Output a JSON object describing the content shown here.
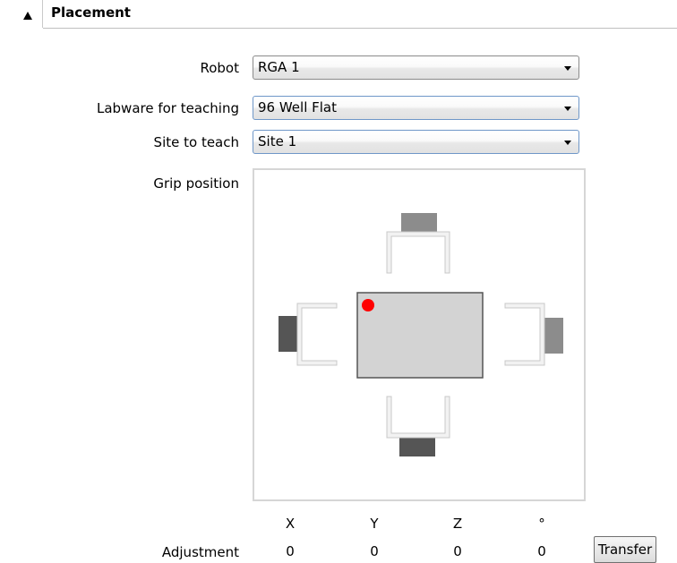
{
  "section": {
    "title": "Placement",
    "collapse_icon": "triangle-up-icon"
  },
  "form": {
    "robot": {
      "label": "Robot",
      "value": "RGA 1"
    },
    "labware": {
      "label": "Labware for teaching",
      "value": "96 Well Flat"
    },
    "site": {
      "label": "Site to teach",
      "value": "Site 1"
    },
    "grip": {
      "label": "Grip position",
      "selected": "left",
      "marker_color": "#ff0000"
    }
  },
  "adjustment": {
    "label": "Adjustment",
    "headers": [
      "X",
      "Y",
      "Z",
      "°"
    ],
    "values": [
      "0",
      "0",
      "0",
      "0"
    ],
    "transfer_label": "Transfer"
  }
}
